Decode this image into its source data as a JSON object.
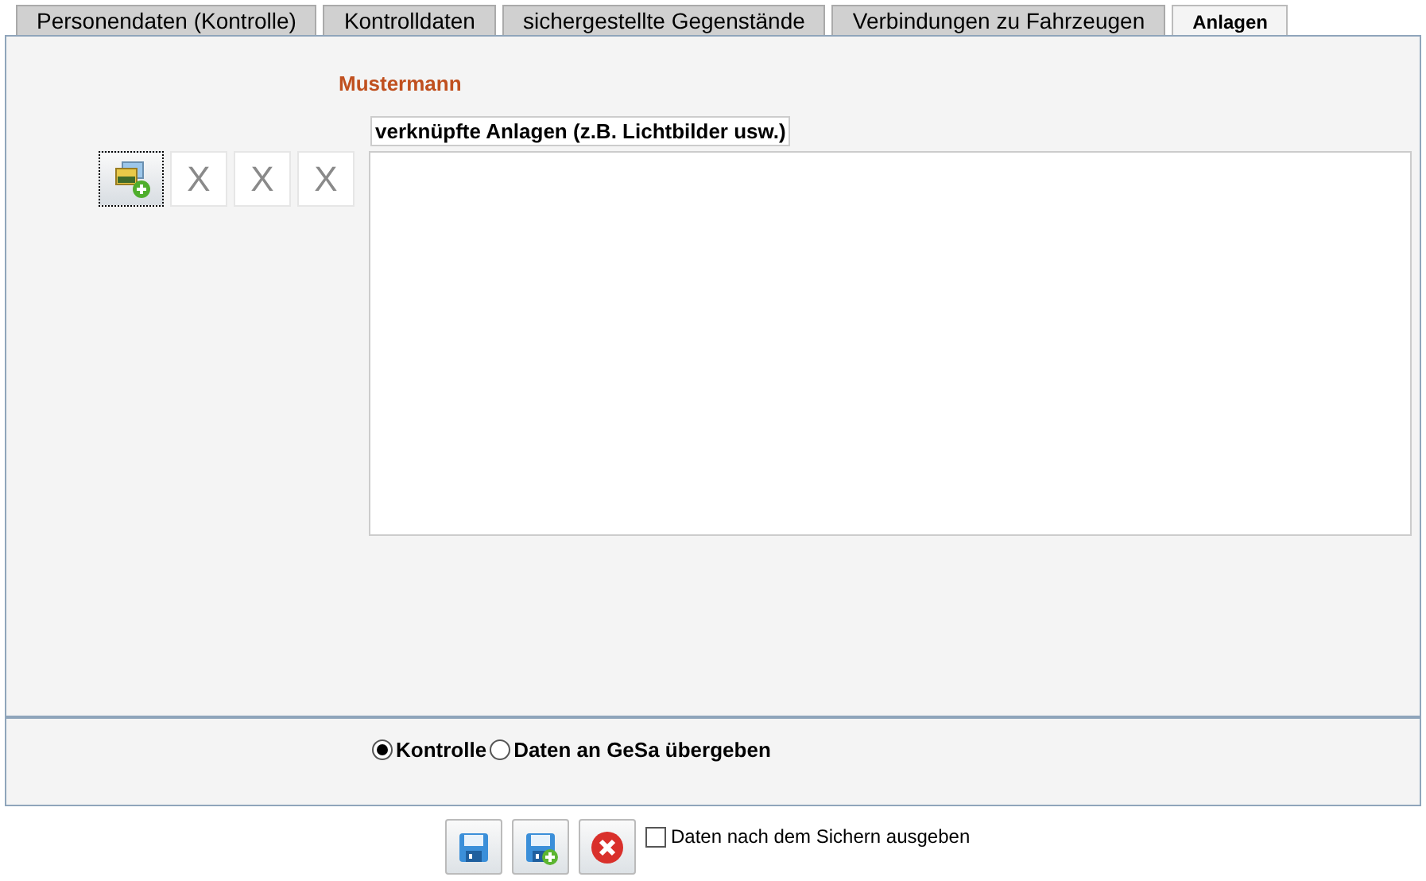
{
  "tabs": [
    {
      "label": "Personendaten (Kontrolle)",
      "selected": false
    },
    {
      "label": "Kontrolldaten",
      "selected": false
    },
    {
      "label": "sichergestellte Gegenstände",
      "selected": false
    },
    {
      "label": "Verbindungen zu Fahrzeugen",
      "selected": false
    },
    {
      "label": "Anlagen",
      "selected": true
    }
  ],
  "person_name": "Mustermann",
  "attachments": {
    "label": "verknüpfte Anlagen (z.B. Lichtbilder usw.)",
    "remove_buttons": [
      {
        "label": "X",
        "disabled": true
      },
      {
        "label": "X",
        "disabled": true
      },
      {
        "label": "X",
        "disabled": true
      }
    ]
  },
  "mode_options": [
    {
      "label": "Kontrolle",
      "selected": true
    },
    {
      "label": "Daten an GeSa übergeben",
      "selected": false
    }
  ],
  "output_after_save": {
    "label": "Daten nach dem Sichern ausgeben",
    "checked": false
  }
}
